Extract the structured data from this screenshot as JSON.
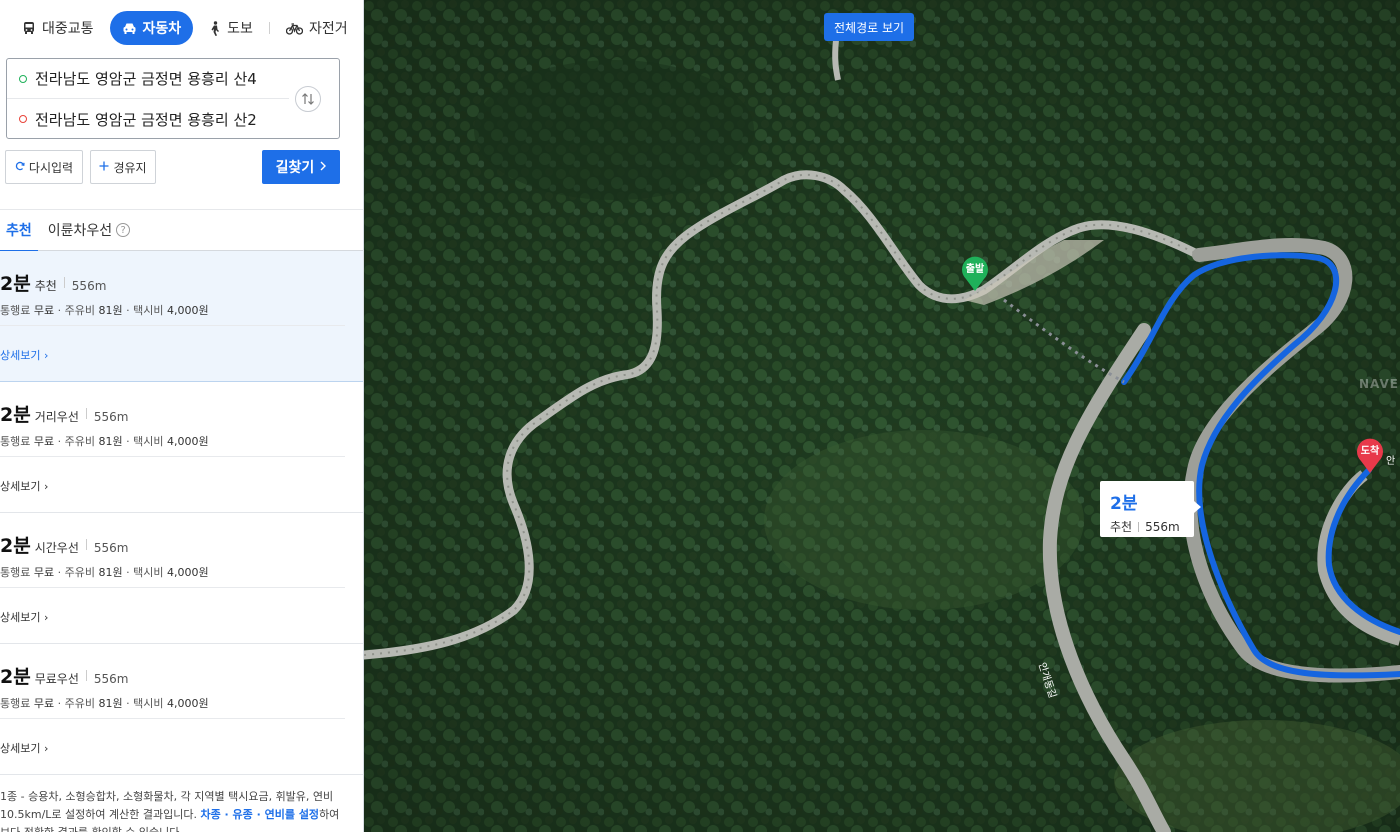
{
  "modes": [
    {
      "label": "대중교통",
      "icon": "bus-icon"
    },
    {
      "label": "자동차",
      "icon": "car-icon",
      "active": true
    },
    {
      "label": "도보",
      "icon": "walk-icon"
    },
    {
      "label": "자전거",
      "icon": "bike-icon"
    }
  ],
  "route": {
    "start": "전라남도 영암군 금정면 용흥리 산4",
    "end": "전라남도 영암군 금정면 용흥리 산2"
  },
  "actions": {
    "reset": "다시입력",
    "waypoint": "경유지",
    "search": "길찾기"
  },
  "tabs": {
    "recommend": "추천",
    "eco": "이륜차우선",
    "help": "?"
  },
  "results": [
    {
      "time": "2분",
      "type": "추천",
      "dist": "556m",
      "toll_label": "통행료",
      "toll": "무료",
      "fuel_label": "주유비",
      "fuel": "81원",
      "taxi_label": "택시비",
      "taxi": "4,000원",
      "detail": "상세보기"
    },
    {
      "time": "2분",
      "type": "거리우선",
      "dist": "556m",
      "toll_label": "통행료",
      "toll": "무료",
      "fuel_label": "주유비",
      "fuel": "81원",
      "taxi_label": "택시비",
      "taxi": "4,000원",
      "detail": "상세보기"
    },
    {
      "time": "2분",
      "type": "시간우선",
      "dist": "556m",
      "toll_label": "통행료",
      "toll": "무료",
      "fuel_label": "주유비",
      "fuel": "81원",
      "taxi_label": "택시비",
      "taxi": "4,000원",
      "detail": "상세보기"
    },
    {
      "time": "2분",
      "type": "무료우선",
      "dist": "556m",
      "toll_label": "통행료",
      "toll": "무료",
      "fuel_label": "주유비",
      "fuel": "81원",
      "taxi_label": "택시비",
      "taxi": "4,000원",
      "detail": "상세보기"
    }
  ],
  "footnote": {
    "text1": "1종 - 승용차, 소형승합차, 소형화물차, 각 지역별 택시요금, 휘발유, 연비 10.5km/L로 설정하여 계산한 결과입니다. ",
    "link": "차종 · 유종 · 연비를 설정",
    "text2": "하여 보다 정확한 결과를 확인할 수 있습니다."
  },
  "map": {
    "full_route": "전체경로 보기",
    "start_pin": "출발",
    "end_pin": "도착",
    "end_pin_suffix": "안",
    "callout_time": "2분",
    "callout_type": "추천",
    "callout_dist": "556m",
    "road_name": "안개동길",
    "watermark": "NAVER"
  },
  "colors": {
    "accent": "#1e6fe8",
    "start": "#1fb15a",
    "end": "#e8443a"
  }
}
